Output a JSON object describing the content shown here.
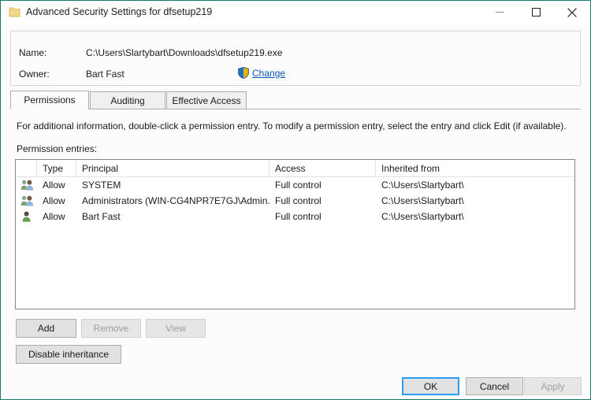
{
  "window": {
    "title": "Advanced Security Settings for dfsetup219",
    "icon": "folder-icon",
    "accent_color": "#12796b",
    "minimize_label": "Minimize",
    "maximize_label": "Maximize",
    "close_label": "Close"
  },
  "info": {
    "name_label": "Name:",
    "name_value": "C:\\Users\\Slartybart\\Downloads\\dfsetup219.exe",
    "owner_label": "Owner:",
    "owner_value": "Bart Fast",
    "change_link": "Change",
    "change_icon": "uac-shield-icon",
    "link_color": "#0a52b5"
  },
  "tabs": [
    {
      "label": "Permissions",
      "selected": true
    },
    {
      "label": "Auditing",
      "selected": false
    },
    {
      "label": "Effective Access",
      "selected": false
    }
  ],
  "content": {
    "instruction": "For additional information, double-click a permission entry. To modify a permission entry, select the entry and click Edit (if available).",
    "entries_label": "Permission entries:"
  },
  "list": {
    "columns": [
      {
        "label": "",
        "key": "icon"
      },
      {
        "label": "Type",
        "key": "type"
      },
      {
        "label": "Principal",
        "key": "principal"
      },
      {
        "label": "Access",
        "key": "access"
      },
      {
        "label": "Inherited from",
        "key": "inherited"
      }
    ],
    "rows": [
      {
        "icon": "group-icon",
        "type": "Allow",
        "principal": "SYSTEM",
        "access": "Full control",
        "inherited": "C:\\Users\\Slartybart\\"
      },
      {
        "icon": "group-icon",
        "type": "Allow",
        "principal": "Administrators (WIN-CG4NPR7E7GJ\\Admin...",
        "access": "Full control",
        "inherited": "C:\\Users\\Slartybart\\"
      },
      {
        "icon": "user-icon",
        "type": "Allow",
        "principal": "Bart Fast",
        "access": "Full control",
        "inherited": "C:\\Users\\Slartybart\\"
      }
    ]
  },
  "actions": {
    "add": "Add",
    "remove": "Remove",
    "view": "View",
    "disable_inheritance": "Disable inheritance"
  },
  "footer": {
    "ok": "OK",
    "cancel": "Cancel",
    "apply": "Apply",
    "default_button_color": "#2a9ef4"
  }
}
